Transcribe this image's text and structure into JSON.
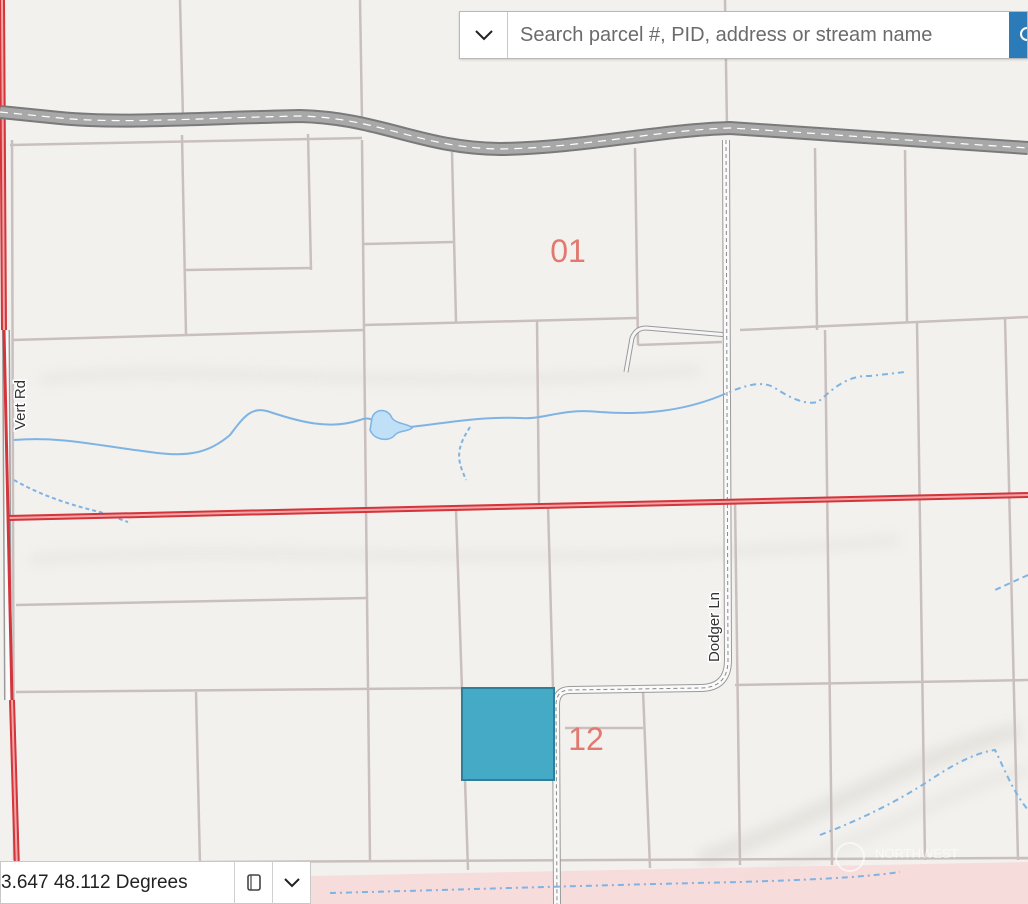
{
  "search": {
    "placeholder": "Search parcel #, PID, address or stream name",
    "dropdown_icon": "chevron-down-icon",
    "button_icon": "search-icon"
  },
  "coordinates": {
    "text": "3.647 48.112 Degrees",
    "copy_icon": "copy-icon",
    "dropdown_icon": "chevron-down-icon"
  },
  "map": {
    "section_labels": [
      "01",
      "12"
    ],
    "road_labels": [
      "Vert Rd",
      "Dodger Ln"
    ],
    "watermark": "NORTHWEST",
    "colors": {
      "background": "#f2f1ee",
      "parcel_line": "#c9bfbf",
      "highway": "#8c8c8c",
      "section_line": "#d2353b",
      "stream": "#7fb3e3",
      "selected_parcel": "#45aac5",
      "section_label": "#e2786e",
      "zone_fill": "#f7d7d7"
    }
  }
}
